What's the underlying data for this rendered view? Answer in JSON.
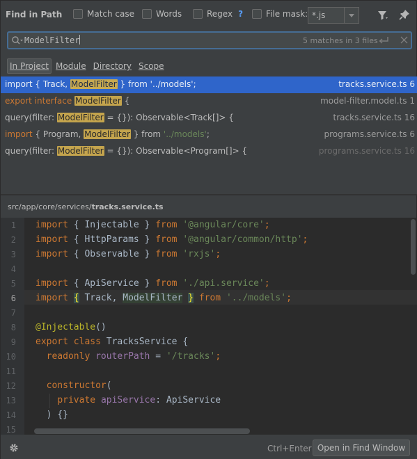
{
  "header": {
    "title": "Find in Path",
    "match_case": "Match case",
    "words": "Words",
    "regex": "Regex",
    "regex_help": "?",
    "file_mask_label": "File mask:",
    "file_mask_value": "*.js"
  },
  "search": {
    "query": "ModelFilter",
    "match_count": "5 matches in 3 files"
  },
  "scope_tabs": [
    "In Project",
    "Module",
    "Directory",
    "Scope"
  ],
  "results": [
    {
      "parts": [
        [
          "",
          "import { Track, "
        ],
        [
          "hl",
          "ModelFilter"
        ],
        [
          "",
          " } from '../models';"
        ]
      ],
      "file": "tracks.service.ts 6",
      "selected": true
    },
    {
      "parts": [
        [
          "kw",
          "export interface "
        ],
        [
          "hl",
          "ModelFilter"
        ],
        [
          "",
          " {"
        ]
      ],
      "file": "model-filter.model.ts 1"
    },
    {
      "parts": [
        [
          "",
          "query(filter: "
        ],
        [
          "hl",
          "ModelFilter"
        ],
        [
          "",
          " = {}): Observable<Track[]> {"
        ]
      ],
      "file": "tracks.service.ts 16"
    },
    {
      "parts": [
        [
          "kw",
          "import"
        ],
        [
          "",
          " { Program, "
        ],
        [
          "hl",
          "ModelFilter"
        ],
        [
          "",
          " } from "
        ],
        [
          "str",
          "'../models'"
        ],
        [
          "",
          ";"
        ]
      ],
      "file": "programs.service.ts 6"
    },
    {
      "parts": [
        [
          "",
          "query(filter: "
        ],
        [
          "hl",
          "ModelFilter"
        ],
        [
          "",
          " = {}): Observable<Program[]> {"
        ]
      ],
      "file": "programs.service.ts 16",
      "file_muted": true
    }
  ],
  "preview": {
    "path_prefix": "src/app/core/services/",
    "path_file": "tracks.service.ts",
    "current_line": 6,
    "lines": [
      [
        [
          "kw",
          "import"
        ],
        [
          "",
          "{ Injectable }"
        ],
        [
          "kw",
          "from"
        ],
        [
          "str",
          "'@angular/core'"
        ],
        [
          "kw",
          ";"
        ]
      ],
      [
        [
          "kw",
          "import"
        ],
        [
          "",
          "{ HttpParams }"
        ],
        [
          "kw",
          "from"
        ],
        [
          "str",
          "'@angular/common/http'"
        ],
        [
          "kw",
          ";"
        ]
      ],
      [
        [
          "kw",
          "import"
        ],
        [
          "",
          "{ Observable }"
        ],
        [
          "kw",
          "from"
        ],
        [
          "str",
          "'rxjs'"
        ],
        [
          "kw",
          ";"
        ]
      ],
      [],
      [
        [
          "kw",
          "import"
        ],
        [
          "",
          "{ ApiService }"
        ],
        [
          "kw",
          "from"
        ],
        [
          "str",
          "'./api.service'"
        ],
        [
          "kw",
          ";"
        ]
      ],
      [
        [
          "kw",
          "import"
        ],
        [
          "brace",
          "{"
        ],
        [
          "",
          "Track,"
        ],
        [
          "hl",
          "ModelFilter"
        ],
        [
          "brace",
          "}"
        ],
        [
          "kw",
          "from"
        ],
        [
          "str",
          "'../models'"
        ],
        [
          "kw",
          ";"
        ]
      ],
      [],
      [
        [
          "dec",
          "@Injectable"
        ],
        [
          "",
          "()"
        ]
      ],
      [
        [
          "kw",
          "export class"
        ],
        [
          "",
          "TracksService {"
        ]
      ],
      [
        [
          "ind",
          "  "
        ],
        [
          "kw",
          "readonly"
        ],
        [
          "fld",
          "routerPath"
        ],
        [
          "",
          "="
        ],
        [
          "str",
          "'/tracks'"
        ],
        [
          "kw",
          ";"
        ]
      ],
      [],
      [
        [
          "ind",
          "  "
        ],
        [
          "kw",
          "constructor"
        ],
        [
          "",
          "("
        ]
      ],
      [
        [
          "ind",
          "    "
        ],
        [
          "kw",
          "private"
        ],
        [
          "fld",
          "apiService"
        ],
        [
          "",
          ": ApiService"
        ]
      ],
      [
        [
          "ind",
          "  "
        ],
        [
          "",
          ") {}"
        ]
      ],
      []
    ]
  },
  "footer": {
    "shortcut": "Ctrl+Enter",
    "open_button": "Open in Find Window"
  }
}
